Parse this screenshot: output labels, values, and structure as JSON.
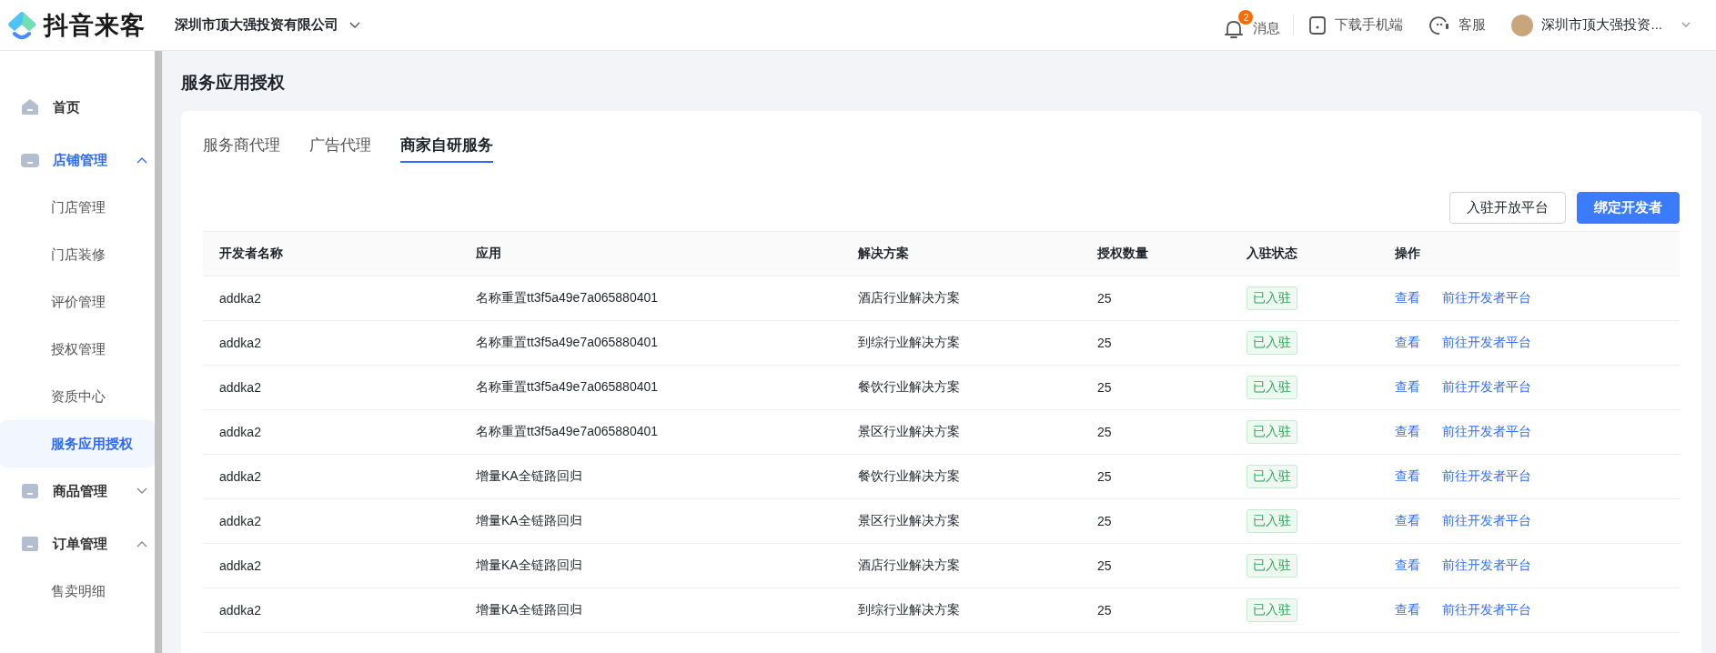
{
  "header": {
    "logo_text": "抖音来客",
    "company": "深圳市顶大强投资有限公司",
    "notifications": {
      "badge": "2",
      "label": "消息"
    },
    "download": "下载手机端",
    "service": "客服",
    "user": "深圳市顶大强投资..."
  },
  "sidebar": {
    "items": [
      {
        "label": "首页"
      },
      {
        "label": "店铺管理",
        "expanded": true,
        "children": [
          {
            "label": "门店管理",
            "selected": false
          },
          {
            "label": "门店装修",
            "selected": false
          },
          {
            "label": "评价管理",
            "selected": false
          },
          {
            "label": "授权管理",
            "selected": false
          },
          {
            "label": "资质中心",
            "selected": false
          },
          {
            "label": "服务应用授权",
            "selected": true
          }
        ]
      },
      {
        "label": "商品管理",
        "expanded": false
      },
      {
        "label": "订单管理",
        "expanded": true,
        "children": [
          {
            "label": "售卖明细",
            "selected": false
          }
        ]
      }
    ]
  },
  "page_title": "服务应用授权",
  "tabs": [
    {
      "label": "服务商代理",
      "selected": false
    },
    {
      "label": "广告代理",
      "selected": false
    },
    {
      "label": "商家自研服务",
      "selected": true
    }
  ],
  "buttons": [
    {
      "label": "入驻开放平台",
      "kind": "default"
    },
    {
      "label": "绑定开发者",
      "kind": "primary"
    }
  ],
  "table": {
    "columns": [
      "开发者名称",
      "应用",
      "解决方案",
      "授权数量",
      "入驻状态",
      "操作"
    ],
    "rows": [
      {
        "developer": "addka2",
        "app": "名称重置tt3f5a49e7a065880401",
        "solution": "酒店行业解决方案",
        "count": "25",
        "status": "已入驻",
        "actions": [
          "查看",
          "前往开发者平台"
        ]
      },
      {
        "developer": "addka2",
        "app": "名称重置tt3f5a49e7a065880401",
        "solution": "到综行业解决方案",
        "count": "25",
        "status": "已入驻",
        "actions": [
          "查看",
          "前往开发者平台"
        ]
      },
      {
        "developer": "addka2",
        "app": "名称重置tt3f5a49e7a065880401",
        "solution": "餐饮行业解决方案",
        "count": "25",
        "status": "已入驻",
        "actions": [
          "查看",
          "前往开发者平台"
        ]
      },
      {
        "developer": "addka2",
        "app": "名称重置tt3f5a49e7a065880401",
        "solution": "景区行业解决方案",
        "count": "25",
        "status": "已入驻",
        "actions": [
          "查看",
          "前往开发者平台"
        ]
      },
      {
        "developer": "addka2",
        "app": "增量KA全链路回归",
        "solution": "餐饮行业解决方案",
        "count": "25",
        "status": "已入驻",
        "actions": [
          "查看",
          "前往开发者平台"
        ]
      },
      {
        "developer": "addka2",
        "app": "增量KA全链路回归",
        "solution": "景区行业解决方案",
        "count": "25",
        "status": "已入驻",
        "actions": [
          "查看",
          "前往开发者平台"
        ]
      },
      {
        "developer": "addka2",
        "app": "增量KA全链路回归",
        "solution": "酒店行业解决方案",
        "count": "25",
        "status": "已入驻",
        "actions": [
          "查看",
          "前往开发者平台"
        ]
      },
      {
        "developer": "addka2",
        "app": "增量KA全链路回归",
        "solution": "到综行业解决方案",
        "count": "25",
        "status": "已入驻",
        "actions": [
          "查看",
          "前往开发者平台"
        ]
      }
    ]
  }
}
